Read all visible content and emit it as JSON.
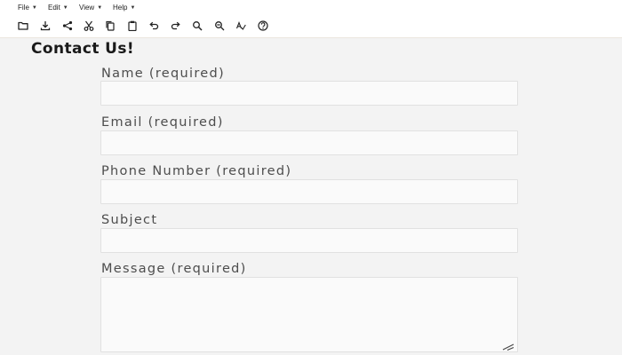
{
  "menubar": {
    "items": [
      {
        "label": "File"
      },
      {
        "label": "Edit"
      },
      {
        "label": "View"
      },
      {
        "label": "Help"
      }
    ]
  },
  "toolbar": {
    "icons": [
      "open-folder-icon",
      "download-icon",
      "share-icon",
      "cut-icon",
      "copy-icon",
      "paste-icon",
      "undo-icon",
      "redo-icon",
      "zoom-in-icon",
      "zoom-out-icon",
      "spellcheck-icon",
      "help-icon"
    ]
  },
  "page": {
    "title": "Contact Us!"
  },
  "form": {
    "name_label": "Name (required)",
    "name_value": "",
    "email_label": "Email (required)",
    "email_value": "",
    "phone_label": "Phone Number (required)",
    "phone_value": "",
    "subject_label": "Subject",
    "subject_value": "",
    "message_label": "Message (required)",
    "message_value": ""
  },
  "colors": {
    "background": "#f3f3f3",
    "input_background": "#fafafa",
    "label_text": "#4d4d4d",
    "title_text": "#1a1a1a"
  }
}
